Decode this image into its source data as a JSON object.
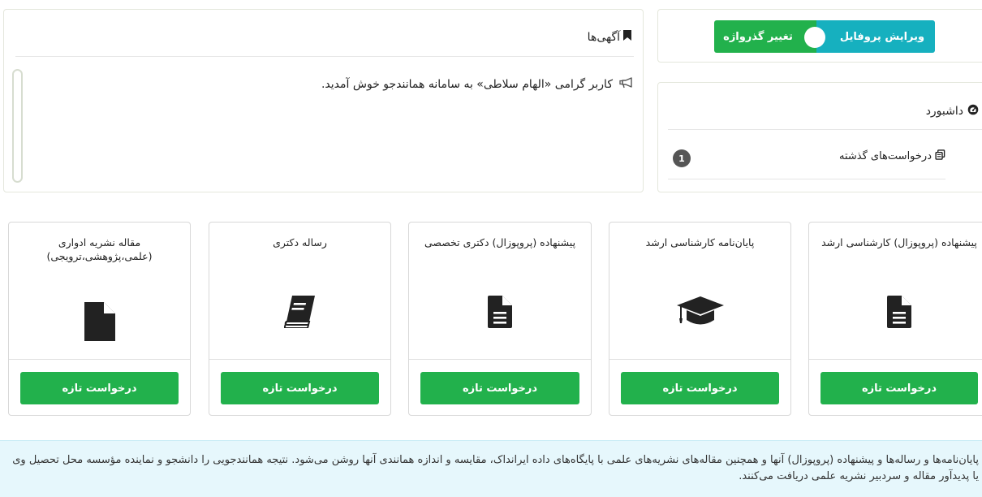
{
  "profile": {
    "edit_profile_label": "ویرایش پروفایل",
    "change_password_label": "تغییر گذرواژه"
  },
  "dashboard": {
    "title": "داشبورد",
    "icon": "dashboard-icon",
    "items": [
      {
        "label": "درخواست‌های گذشته",
        "icon": "copy-icon",
        "count": "1"
      }
    ]
  },
  "announcements": {
    "title": "آگهی‌ها",
    "icon": "bookmark-icon",
    "items": [
      {
        "text": "کاربر گرامی «الهام سلاطی» به سامانه همانندجو خوش آمدید.",
        "icon": "bullhorn-icon"
      }
    ]
  },
  "cards": [
    {
      "title": "پیشنهاده (پروپوزال) کارشناسی ارشد",
      "icon": "file-text-icon",
      "button": "درخواست تازه"
    },
    {
      "title": "پایان‌نامه کارشناسی ارشد",
      "icon": "graduation-cap-icon",
      "button": "درخواست تازه"
    },
    {
      "title": "پیشنهاده (پروپوزال) دکتری تخصصی",
      "icon": "file-text-icon",
      "button": "درخواست تازه"
    },
    {
      "title": "رساله دکتری",
      "icon": "book-icon",
      "button": "درخواست تازه"
    },
    {
      "title": "مقاله نشریه ادواری (علمی،پژوهشی،ترویجی)",
      "icon": "file-icon",
      "button": "درخواست تازه"
    }
  ],
  "info": {
    "text": "پایان‌نامه‌ها و رساله‌ها و پیشنهاده (پروپوزال) آنها و همچنین مقاله‌های نشریه‌های علمی با پایگاه‌های داده ایرانداک، مقایسه و اندازه همانندی آنها روشن می‌شود. نتیجه همانندجویی را دانشجو و نماینده مؤسسه محل تحصیل وی یا پدیدآور مقاله و سردبیر نشریه علمی دریافت می‌کنند."
  },
  "colors": {
    "green": "#22b14c",
    "teal": "#16b0bf",
    "info_bg": "#e6f7fc"
  }
}
